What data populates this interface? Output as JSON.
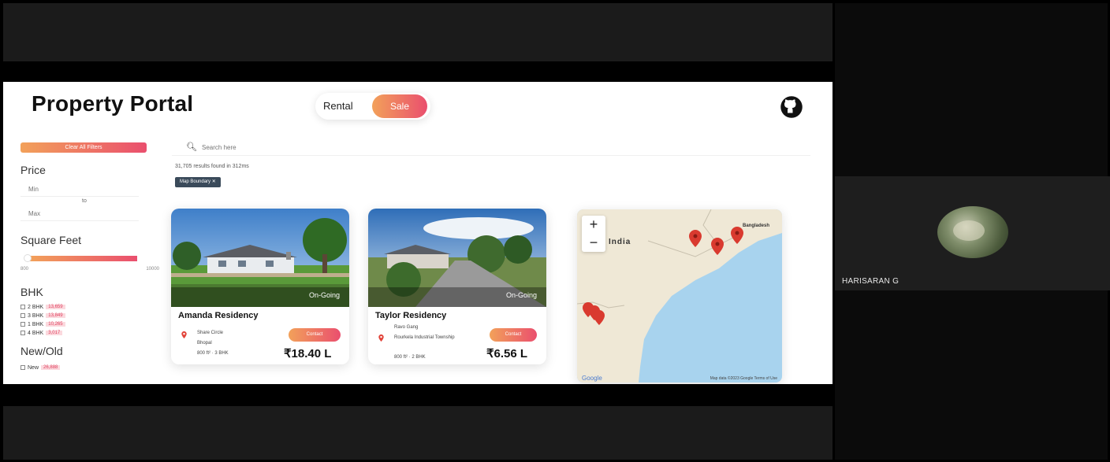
{
  "app": {
    "title": "Property Portal",
    "toggle": {
      "rental": "Rental",
      "sale": "Sale"
    }
  },
  "sidebar": {
    "clear_label": "Clear All Filters",
    "price": {
      "heading": "Price",
      "min_placeholder": "Min",
      "to": "to",
      "max_placeholder": "Max"
    },
    "sqft": {
      "heading": "Square Feet",
      "min": "800",
      "max": "10000"
    },
    "bhk": {
      "heading": "BHK",
      "options": [
        {
          "label": "2 BHK",
          "count": "13,659"
        },
        {
          "label": "3 BHK",
          "count": "13,849"
        },
        {
          "label": "1 BHK",
          "count": "10,265"
        },
        {
          "label": "4 BHK",
          "count": "3,017"
        }
      ]
    },
    "newold": {
      "heading": "New/Old",
      "option": "New",
      "count": "26,888"
    }
  },
  "search": {
    "placeholder": "Search here",
    "results": "31,705 results found in 312ms",
    "chip": "Map Boundary ✕"
  },
  "listings": [
    {
      "status": "On-Going",
      "name": "Amanda Residency",
      "addr1": "Share Circle",
      "addr2": "Bhopal",
      "meta": "800 ft² · 3 BHK",
      "action": "Contact",
      "price": "₹18.40 L"
    },
    {
      "status": "On-Going",
      "name": "Taylor Residency",
      "addr1": "Ravo Gang",
      "addr2": "Rourkela Industrial Township",
      "meta": "800 ft² · 2 BHK",
      "action": "Contact",
      "price": "₹6.56 L"
    }
  ],
  "map": {
    "zoom_in": "+",
    "zoom_out": "−",
    "country": "India",
    "region": "Bangladesh",
    "google": "Google",
    "terms": "Map data ©2023 Google   Terms of Use"
  },
  "participant": {
    "name": "HARISARAN G"
  },
  "colors": {
    "accent_start": "#f2a15a",
    "accent_end": "#ea4f6e",
    "chip": "#3a4a5a"
  }
}
